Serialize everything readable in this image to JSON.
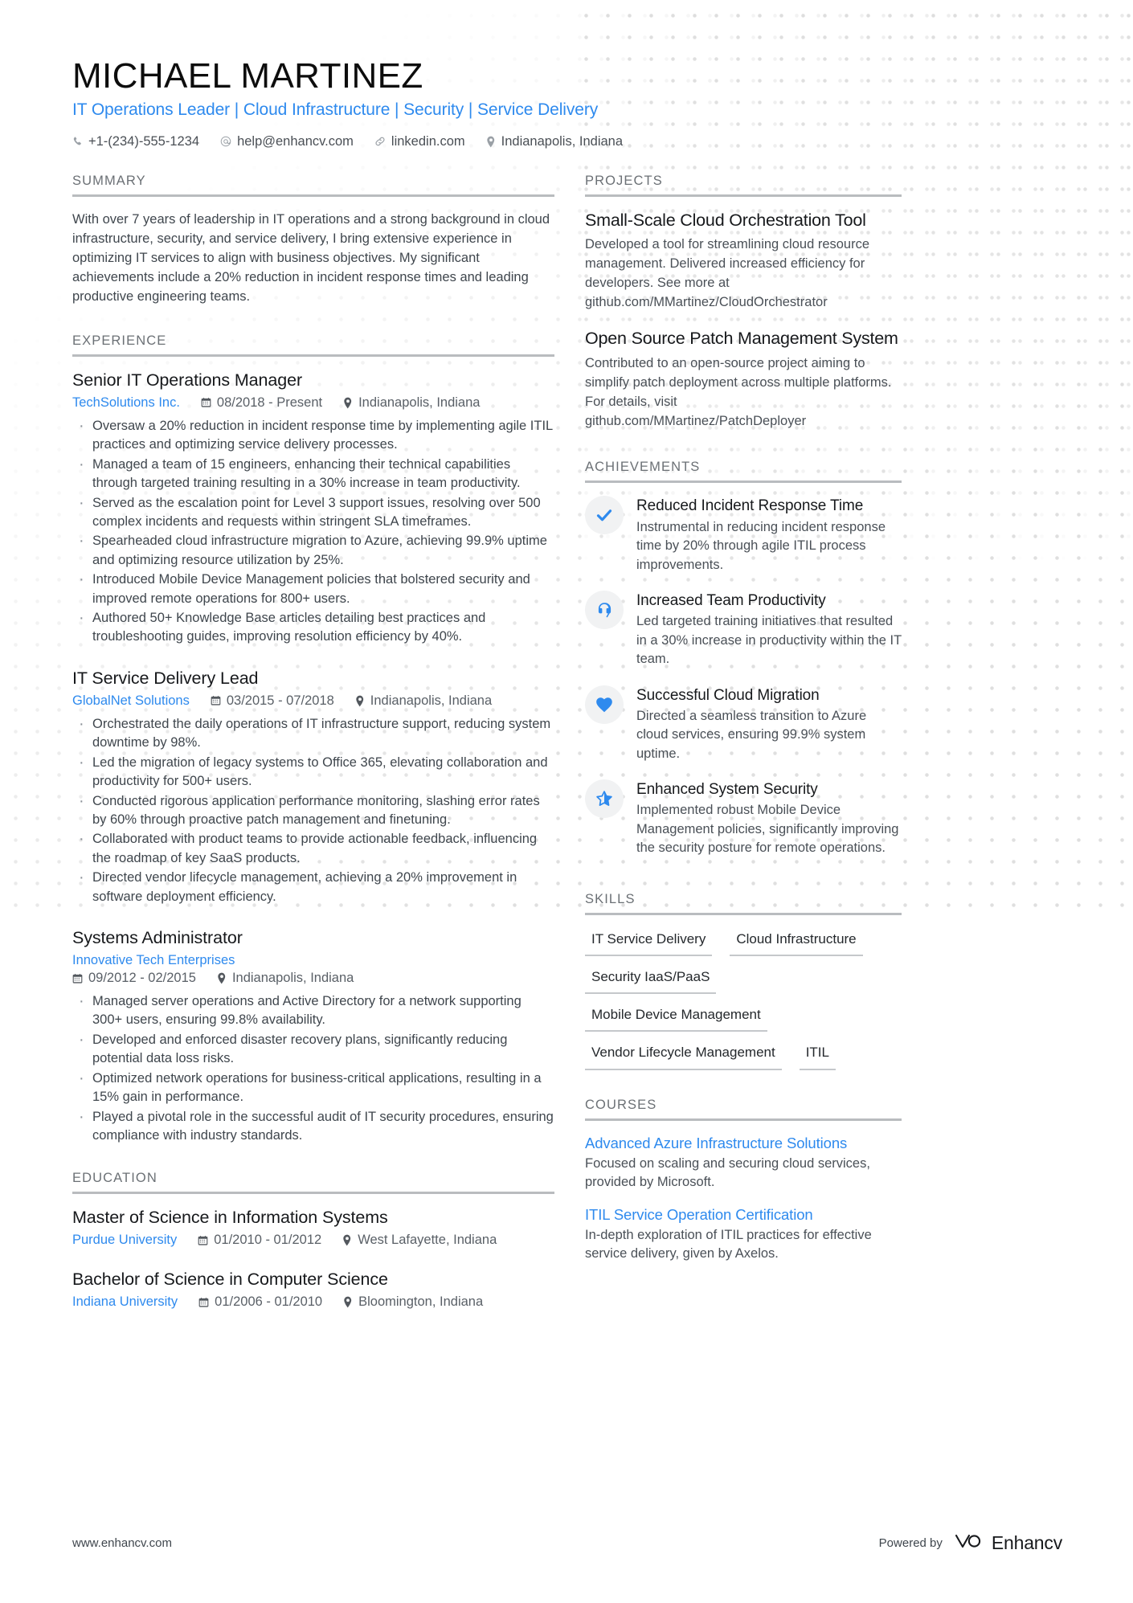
{
  "theme": {
    "accent": "#2e8aee",
    "heading_rule": "#b9bcbf",
    "text": "#3f464d"
  },
  "header": {
    "name": "MICHAEL MARTINEZ",
    "headline": "IT Operations Leader | Cloud Infrastructure | Security | Service Delivery",
    "contacts": [
      {
        "icon": "phone-icon",
        "text": "+1-(234)-555-1234"
      },
      {
        "icon": "email-icon",
        "text": "help@enhancv.com"
      },
      {
        "icon": "link-icon",
        "text": "linkedin.com"
      },
      {
        "icon": "location-icon",
        "text": "Indianapolis, Indiana"
      }
    ]
  },
  "left": {
    "summary": {
      "title": "SUMMARY",
      "text": "With over 7 years of leadership in IT operations and a strong background in cloud infrastructure, security, and service delivery, I bring extensive experience in optimizing IT services to align with business objectives. My significant achievements include a 20% reduction in incident response times and leading productive engineering teams."
    },
    "experience": {
      "title": "EXPERIENCE",
      "jobs": [
        {
          "title": "Senior IT Operations Manager",
          "company": "TechSolutions Inc.",
          "dates": "08/2018 - Present",
          "location": "Indianapolis, Indiana",
          "bullets": [
            "Oversaw a 20% reduction in incident response time by implementing agile ITIL practices and optimizing service delivery processes.",
            "Managed a team of 15 engineers, enhancing their technical capabilities through targeted training resulting in a 30% increase in team productivity.",
            "Served as the escalation point for Level 3 support issues, resolving over 500 complex incidents and requests within stringent SLA timeframes.",
            "Spearheaded cloud infrastructure migration to Azure, achieving 99.9% uptime and optimizing resource utilization by 25%.",
            "Introduced Mobile Device Management policies that bolstered security and improved remote operations for 800+ users.",
            "Authored 50+ Knowledge Base articles detailing best practices and troubleshooting guides, improving resolution efficiency by 40%."
          ]
        },
        {
          "title": "IT Service Delivery Lead",
          "company": "GlobalNet Solutions",
          "dates": "03/2015 - 07/2018",
          "location": "Indianapolis, Indiana",
          "bullets": [
            "Orchestrated the daily operations of IT infrastructure support, reducing system downtime by 98%.",
            "Led the migration of legacy systems to Office 365, elevating collaboration and productivity for 500+ users.",
            "Conducted rigorous application performance monitoring, slashing error rates by 60% through proactive patch management and finetuning.",
            "Collaborated with product teams to provide actionable feedback, influencing the roadmap of key SaaS products.",
            "Directed vendor lifecycle management, achieving a 20% improvement in software deployment efficiency."
          ]
        },
        {
          "title": "Systems Administrator",
          "company": "Innovative Tech Enterprises",
          "dates": "09/2012 - 02/2015",
          "location": "Indianapolis, Indiana",
          "bullets": [
            "Managed server operations and Active Directory for a network supporting 300+ users, ensuring 99.8% availability.",
            "Developed and enforced disaster recovery plans, significantly reducing potential data loss risks.",
            "Optimized network operations for business-critical applications, resulting in a 15% gain in performance.",
            "Played a pivotal role in the successful audit of IT security procedures, ensuring compliance with industry standards."
          ]
        }
      ]
    },
    "education": {
      "title": "EDUCATION",
      "items": [
        {
          "degree": "Master of Science in Information Systems",
          "school": "Purdue University",
          "dates": "01/2010 - 01/2012",
          "location": "West Lafayette, Indiana"
        },
        {
          "degree": "Bachelor of Science in Computer Science",
          "school": "Indiana University",
          "dates": "01/2006 - 01/2010",
          "location": "Bloomington, Indiana"
        }
      ]
    }
  },
  "right": {
    "projects": {
      "title": "PROJECTS",
      "items": [
        {
          "name": "Small-Scale Cloud Orchestration Tool",
          "description": "Developed a tool for streamlining cloud resource management. Delivered increased efficiency for developers. See more at github.com/MMartinez/CloudOrchestrator"
        },
        {
          "name": "Open Source Patch Management System",
          "description": "Contributed to an open-source project aiming to simplify patch deployment across multiple platforms. For details, visit github.com/MMartinez/PatchDeployer"
        }
      ]
    },
    "achievements": {
      "title": "ACHIEVEMENTS",
      "items": [
        {
          "icon": "check-icon",
          "title": "Reduced Incident Response Time",
          "description": "Instrumental in reducing incident response time by 20% through agile ITIL process improvements."
        },
        {
          "icon": "headset-icon",
          "title": "Increased Team Productivity",
          "description": "Led targeted training initiatives that resulted in a 30% increase in productivity within the IT team."
        },
        {
          "icon": "heart-icon",
          "title": "Successful Cloud Migration",
          "description": "Directed a seamless transition to Azure cloud services, ensuring 99.9% system uptime."
        },
        {
          "icon": "half-star-icon",
          "title": "Enhanced System Security",
          "description": "Implemented robust Mobile Device Management policies, significantly improving the security posture for remote operations."
        }
      ]
    },
    "skills": {
      "title": "SKILLS",
      "items": [
        "IT Service Delivery",
        "Cloud Infrastructure",
        "Security IaaS/PaaS",
        "Mobile Device Management",
        "Vendor Lifecycle Management",
        "ITIL"
      ]
    },
    "courses": {
      "title": "COURSES",
      "items": [
        {
          "name": "Advanced Azure Infrastructure Solutions",
          "description": "Focused on scaling and securing cloud services, provided by Microsoft."
        },
        {
          "name": "ITIL Service Operation Certification",
          "description": "In-depth exploration of ITIL practices for effective service delivery, given by Axelos."
        }
      ]
    }
  },
  "footer": {
    "url": "www.enhancv.com",
    "powered_by": "Powered by",
    "brand": "Enhancv"
  }
}
